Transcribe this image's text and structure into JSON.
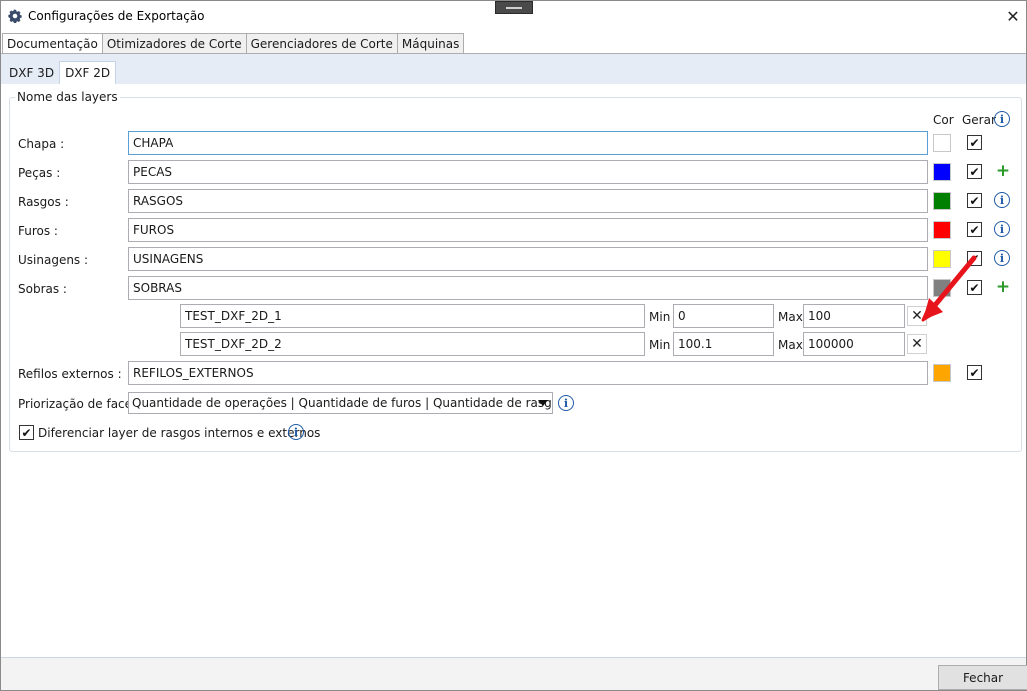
{
  "window": {
    "title": "Configurações de Exportação"
  },
  "tabs": [
    "Documentação",
    "Otimizadores de Corte",
    "Gerenciadores de Corte",
    "Máquinas"
  ],
  "subtabs": [
    "DXF 3D",
    "DXF 2D"
  ],
  "group": {
    "title": "Nome das layers"
  },
  "headers": {
    "cor": "Cor",
    "gerar": "Gerar"
  },
  "layers": [
    {
      "label": "Chapa :",
      "value": "CHAPA",
      "color": "#ffffff",
      "checked": true
    },
    {
      "label": "Peças :",
      "value": "PECAS",
      "color": "#0000ff",
      "checked": true
    },
    {
      "label": "Rasgos :",
      "value": "RASGOS",
      "color": "#008000",
      "checked": true
    },
    {
      "label": "Furos :",
      "value": "FUROS",
      "color": "#ff0000",
      "checked": true
    },
    {
      "label": "Usinagens :",
      "value": "USINAGENS",
      "color": "#ffff00",
      "checked": true
    },
    {
      "label": "Sobras :",
      "value": "SOBRAS",
      "color": "#808080",
      "checked": true
    }
  ],
  "sobras_ranges": [
    {
      "name": "TEST_DXF_2D_1",
      "min_label": "Min",
      "min": "0",
      "max_label": "Max",
      "max": "100"
    },
    {
      "name": "TEST_DXF_2D_2",
      "min_label": "Min",
      "min": "100.1",
      "max_label": "Max",
      "max": "100000"
    }
  ],
  "refilos": {
    "label": "Refilos externos :",
    "value": "REFILOS_EXTERNOS",
    "color": "#ffa500",
    "checked": true
  },
  "priorizacao": {
    "label": "Priorização de face :",
    "value": "Quantidade de operações | Quantidade de furos | Quantidade de rasgos | Quantidade"
  },
  "diferenciar": {
    "label": "Diferenciar layer de rasgos internos e externos",
    "checked": true
  },
  "footer": {
    "close_label": "Fechar"
  },
  "icons": {
    "app": "gear-icon",
    "info": "info-icon",
    "add": "plus-icon",
    "remove": "close-icon",
    "annotation": "red-arrow-icon"
  },
  "colors": {
    "accent_border": "#5a9fd4",
    "arrow": "#e8141c"
  }
}
